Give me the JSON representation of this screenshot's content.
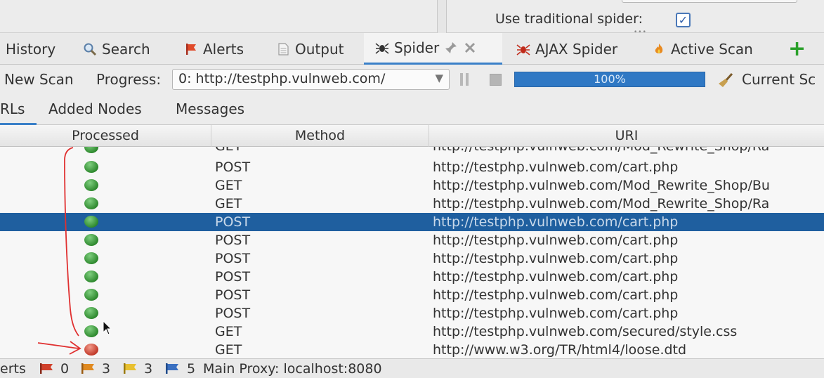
{
  "options": {
    "use_traditional_spider_label": "Use traditional spider:",
    "use_traditional_spider_checked": true,
    "check_glyph": "✓"
  },
  "tabs": [
    {
      "label": "History",
      "icon": "history-icon"
    },
    {
      "label": "Search",
      "icon": "search-icon"
    },
    {
      "label": "Alerts",
      "icon": "alerts-flag-icon"
    },
    {
      "label": "Output",
      "icon": "output-document-icon"
    },
    {
      "label": "Spider",
      "icon": "spider-icon",
      "active": true
    },
    {
      "label": "AJAX Spider",
      "icon": "ajax-spider-icon"
    },
    {
      "label": "Active Scan",
      "icon": "active-scan-flame-icon"
    }
  ],
  "add_tab_glyph": "+",
  "toolbar": {
    "new_scan_label": "New Scan",
    "progress_label": "Progress:",
    "progress_select_value": "0: http://testphp.vulnweb.com/",
    "progress_percent_text": "100%",
    "progress_value": 1.0,
    "current_scans_label": "Current Sc"
  },
  "subtabs": [
    {
      "label": "RLs",
      "active": true
    },
    {
      "label": "Added Nodes"
    },
    {
      "label": "Messages"
    }
  ],
  "table": {
    "columns": [
      "Processed",
      "Method",
      "URI"
    ],
    "rows": [
      {
        "processed": "green",
        "method": "GET",
        "uri": "http://testphp.vulnweb.com/Mod_Rewrite_Shop/Ra"
      },
      {
        "processed": "green",
        "method": "POST",
        "uri": "http://testphp.vulnweb.com/cart.php"
      },
      {
        "processed": "green",
        "method": "GET",
        "uri": "http://testphp.vulnweb.com/Mod_Rewrite_Shop/Bu"
      },
      {
        "processed": "green",
        "method": "GET",
        "uri": "http://testphp.vulnweb.com/Mod_Rewrite_Shop/Ra"
      },
      {
        "processed": "green",
        "method": "POST",
        "uri": "http://testphp.vulnweb.com/cart.php",
        "selected": true
      },
      {
        "processed": "green",
        "method": "POST",
        "uri": "http://testphp.vulnweb.com/cart.php"
      },
      {
        "processed": "green",
        "method": "POST",
        "uri": "http://testphp.vulnweb.com/cart.php"
      },
      {
        "processed": "green",
        "method": "POST",
        "uri": "http://testphp.vulnweb.com/cart.php"
      },
      {
        "processed": "green",
        "method": "POST",
        "uri": "http://testphp.vulnweb.com/cart.php"
      },
      {
        "processed": "green",
        "method": "POST",
        "uri": "http://testphp.vulnweb.com/cart.php"
      },
      {
        "processed": "green",
        "method": "GET",
        "uri": "http://testphp.vulnweb.com/secured/style.css"
      },
      {
        "processed": "red",
        "method": "GET",
        "uri": "http://www.w3.org/TR/html4/loose.dtd"
      }
    ]
  },
  "status_bar": {
    "alerts_label": "erts",
    "counts": [
      {
        "value": "0",
        "color": "#d0402a"
      },
      {
        "value": "3",
        "color": "#e08a20"
      },
      {
        "value": "3",
        "color": "#e8c030"
      },
      {
        "value": "5",
        "color": "#3a6fc0"
      }
    ],
    "proxy_text": "Main Proxy: localhost:8080"
  },
  "colors": {
    "accent": "#3a80c8",
    "selection": "#1f5f9f",
    "progress_fill": "#2f78c4",
    "status_ok": "#2f8a2f",
    "status_error": "#c23a2a",
    "annotation": "#e03030"
  }
}
